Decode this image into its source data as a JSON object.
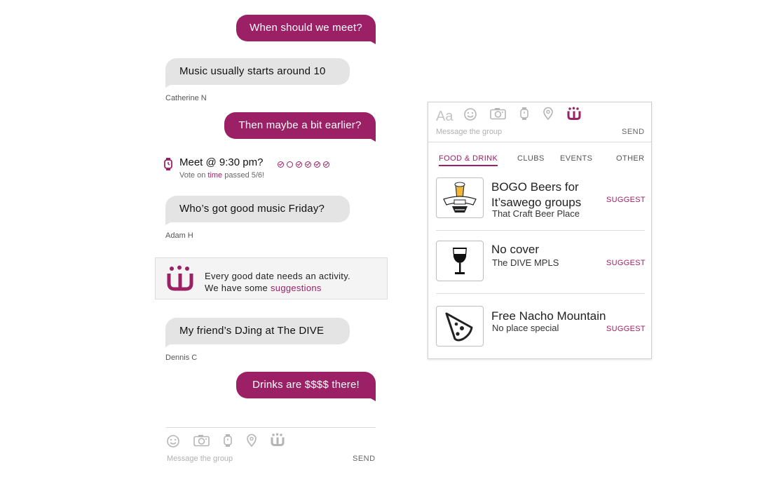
{
  "chat": {
    "messages": [
      {
        "type": "out",
        "text": "When should we meet?"
      },
      {
        "type": "in",
        "text": "Music usually starts around 10",
        "sender": "Catherine N"
      },
      {
        "type": "out",
        "text": "Then maybe a bit earlier?"
      },
      {
        "type": "in",
        "text": "Who’s got good music Friday?",
        "sender": "Adam H"
      },
      {
        "type": "in",
        "text": "My friend’s DJing at The DIVE",
        "sender": "Dennis C"
      },
      {
        "type": "out",
        "text": "Drinks are $$$$ there!"
      }
    ],
    "vote": {
      "title": "Meet @ 9:30 pm?",
      "sub_prefix": "Vote on",
      "sub_highlight": "time",
      "sub_suffix": "passed 5/6!",
      "votes_passed": 5,
      "votes_total": 6
    },
    "banner": {
      "line1": "Every good date needs an activity.",
      "line2_prefix": "We have some",
      "line2_link": "suggestions"
    }
  },
  "composer": {
    "placeholder": "Message the group",
    "send_label": "SEND",
    "icons": [
      "emoji-icon",
      "camera-icon",
      "watch-icon",
      "location-pin-icon",
      "itsawego-icon"
    ]
  },
  "panel": {
    "composer_font_icon": "Aa",
    "placeholder": "Message the group",
    "send_label": "SEND",
    "tabs": [
      {
        "label": "FOOD & DRINK",
        "active": true
      },
      {
        "label": "CLUBS",
        "active": false
      },
      {
        "label": "EVENTS",
        "active": false
      },
      {
        "label": "OTHER",
        "active": false
      }
    ],
    "deals": [
      {
        "title_line1": "BOGO Beers for",
        "title_line2": "It’sawego groups",
        "place": "That Craft Beer Place",
        "action": "SUGGEST",
        "icon": "craft-beer-logo"
      },
      {
        "title_line1": "No cover",
        "title_line2": "",
        "place": "The DIVE MPLS",
        "action": "SUGGEST",
        "icon": "wine-glass-icon"
      },
      {
        "title_line1": "Free Nacho Mountain",
        "title_line2": "",
        "place": "No place special",
        "action": "SUGGEST",
        "icon": "nacho-icon"
      }
    ]
  },
  "colors": {
    "accent": "#9c2065",
    "bubble_in": "#e4e4e4",
    "banner_bg": "#f4f4f4"
  }
}
